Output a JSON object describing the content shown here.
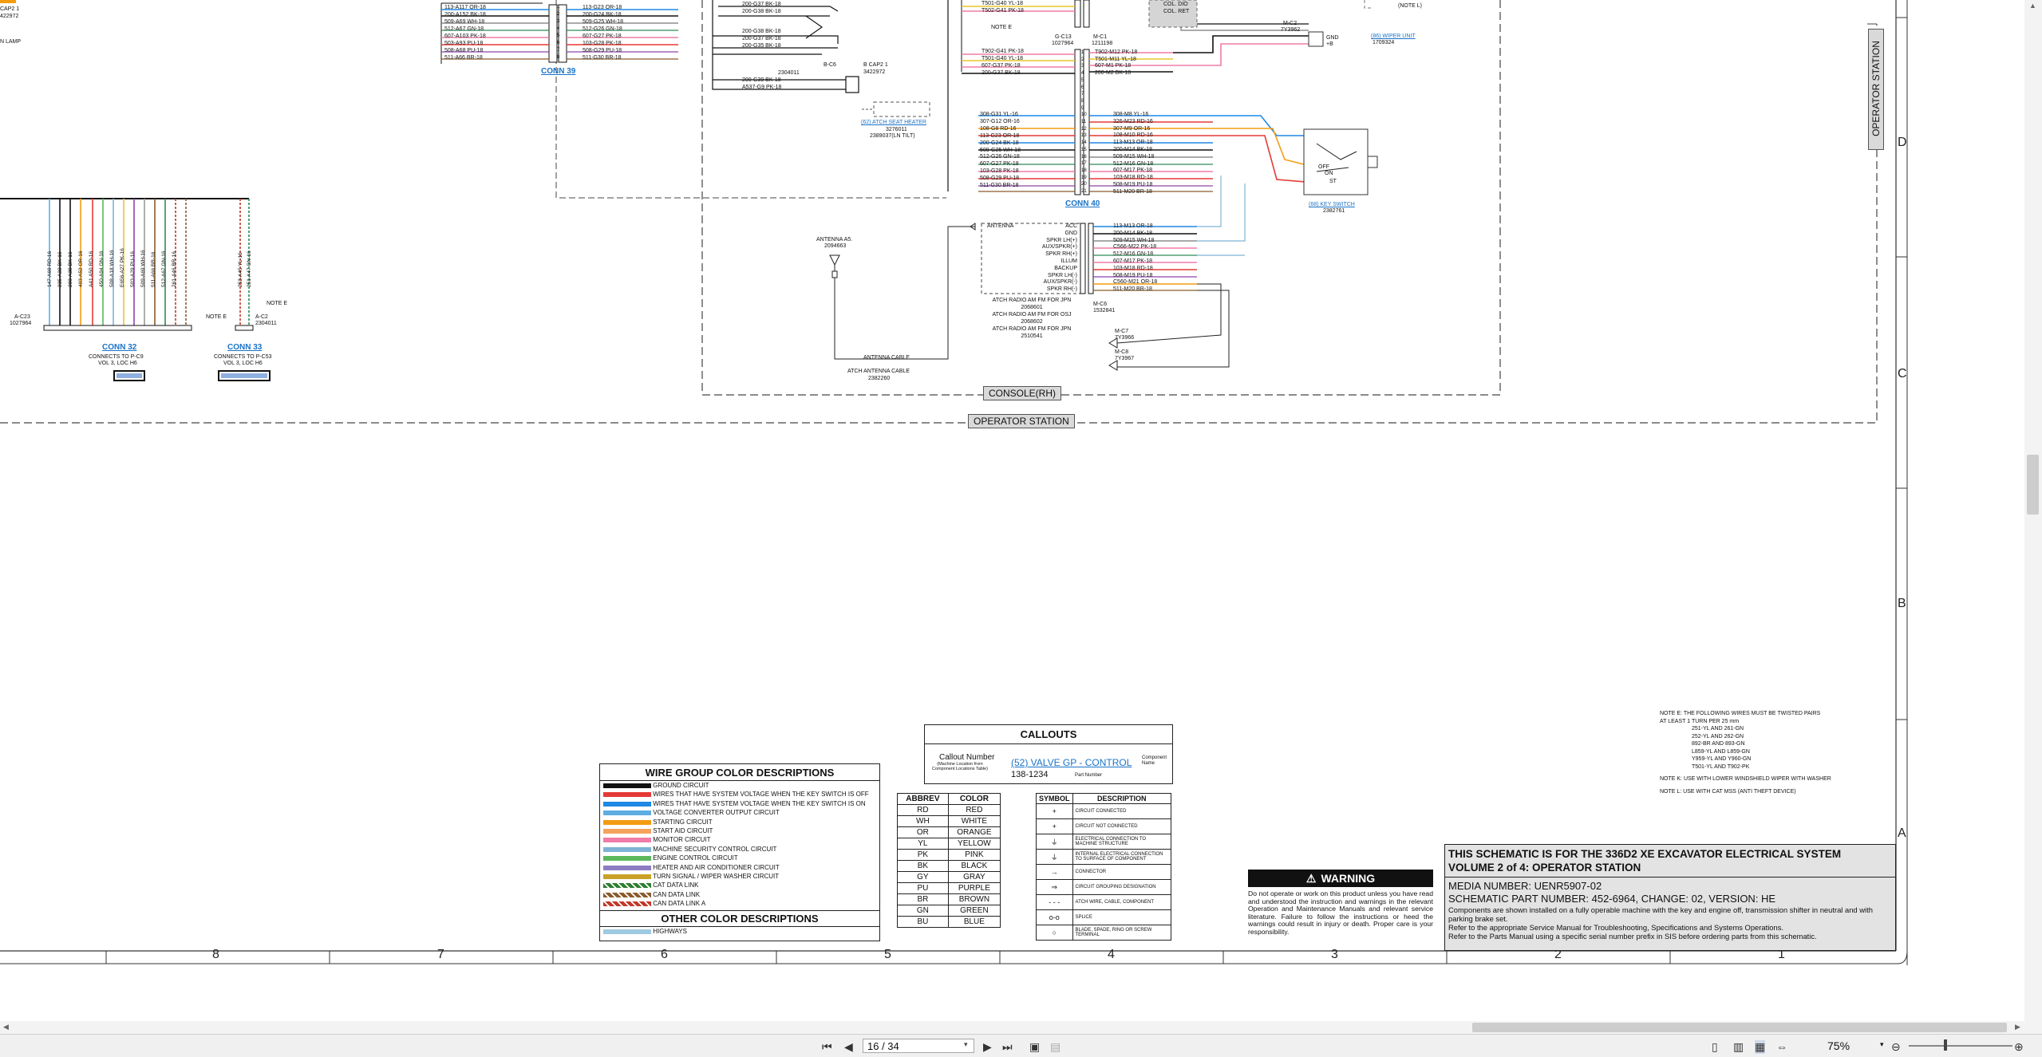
{
  "partial_labels": {
    "top_left_1": "CAP2 1",
    "top_left_2": "422972",
    "lamp": "N LAMP"
  },
  "connectors": {
    "conn39": "CONN 39",
    "conn40": "CONN 40",
    "conn32": "CONN 32",
    "conn33": "CONN 33",
    "conn32_note": "CONNECTS TO P-C9",
    "conn32_vol": "VOL 3, LOC H6",
    "conn33_note": "CONNECTS TO P-C53",
    "conn33_vol": "VOL 3, LOC H6",
    "ac23": "A-C23",
    "ac23_pn": "1027964",
    "ac2": "A-C2",
    "ac2_pn": "2304011",
    "note_e_1": "NOTE E",
    "note_e_2": "NOTE E",
    "note_e_3": "NOTE E",
    "bc6": "B-C6",
    "bc6_pn": "2304011",
    "bcap2": "B CAP2 1",
    "bcap2_pn": "3422972",
    "seat_heater": "(62) ATCH SEAT HEATER",
    "seat_heater_pn1": "3276011",
    "seat_heater_pn2": "2389037(LN TILT)",
    "gc13": "G-C13",
    "gc13_pn": "1027964",
    "mc1": "M-C1",
    "mc1_pn": "1211198",
    "mc2": "M-C2",
    "mc2_pn": "7Y3962",
    "gnd": "GND",
    "gnd2": "+B",
    "wiper_unit": "(86) WIPER UNIT",
    "wiper_pn": "1709324",
    "note_l": "(NOTE L)",
    "col_top1": "COL. DIO",
    "col_top2": "COL. RET",
    "key_switch": "(68) KEY SWITCH",
    "key_switch_pn": "2382761",
    "key_labels": [
      "OFF",
      "ON",
      "ST"
    ],
    "antenna": "ANTENNA A5.",
    "antenna_pn": "2094663",
    "antenna_cable": "ANTENNA CABLE",
    "atch_antenna": "ATCH ANTENNA CABLE",
    "atch_antenna_pn": "2382260",
    "radio_lines": [
      "ATCH RADIO AM FM FOR JPN",
      "2068601",
      "ATCH RADIO AM FM FOR OSJ",
      "2068602",
      "ATCH RADIO AM FM FOR JPN",
      "2510541"
    ],
    "radio_pins": [
      "ACC",
      "GND",
      "SPKR LH(+)",
      "AUX/SPKR(+)",
      "SPKR RH(+)",
      "ILLUM",
      "BACKUP",
      "SPKR LH(-)",
      "AUX/SPKR(-)",
      "SPKR RH(-)"
    ],
    "radio_antenna": "ANTENNA",
    "mc6": "M-C6",
    "mc6_pn": "1532841",
    "mc7": "M-C7",
    "mc7_pn": "7Y3966",
    "mc8": "M-C8",
    "mc8_pn": "7Y3967",
    "note_b": "NOTE B",
    "console_rh": "CONSOLE(RH)",
    "operator_station": "OPERATOR STATION",
    "operator_station_side": "OPERATOR STATION"
  },
  "wire_rows": {
    "conn39_left": [
      "113-A117 OR-18",
      "200-A152 BK-18",
      "509-A69 WH-18",
      "512-A67 GN-18",
      "607-A103 PK-18",
      "503-A93 PU-18",
      "508-A68 PU-18",
      "511-A66 BR-18"
    ],
    "conn39_right": [
      "113-G23 OR-18",
      "200-G24 BK-18",
      "509-G25 WH-18",
      "512-G26 GN-18",
      "607-G27 PK-18",
      "103-G28 PK-18",
      "508-G29 PU-18",
      "511-G30 BR-18"
    ],
    "conn39_pins": [
      "1",
      "2",
      "3",
      "4",
      "5",
      "6",
      "7",
      "8"
    ],
    "upper_mid": [
      "200-G37 BK-18",
      "200-G38 BK-18",
      "200-G38 BK-18",
      "200-G37 BK-18",
      "200-G35 BK-18"
    ],
    "lower_mid": [
      "200-G39 BK-18",
      "A537-G9 PK-18"
    ],
    "conn40_left_top": [
      "T501-G40 YL-18",
      "T502-G41 PK-18"
    ],
    "conn40_left_mid": [
      "T902-G41 PK-18",
      "T501-G40 YL-18",
      "607-G37 PK-18",
      "200-G37 BK-18"
    ],
    "conn40_left": [
      "308-G31 YL-16",
      "307-G12 OR-16",
      "108-G8 RD-16",
      "113-G23 OR-18",
      "200-G24 BK-18",
      "509-G25 WH-18",
      "512-G26 GN-18",
      "607-G27 PK-18",
      "103-G28 PK-18",
      "508-G29 PU-18",
      "511-G30 BR-18"
    ],
    "conn40_right_top": [
      "T902-M12 PK-18",
      "T501-M11 YL-18",
      "607-M1 PK-18",
      "200-M2 BK-18"
    ],
    "conn40_right": [
      "308-M8 YL-16",
      "326-M23 RD-16",
      "307-M9 OR-16",
      "108-M10 RD-16",
      "113-M13 OR-18",
      "200-M14 BK-18",
      "509-M15 WH-18",
      "512-M16 GN-18",
      "607-M17 PK-18",
      "103-M18 RD-18",
      "508-M19 PU-18",
      "511-M20 BR-18"
    ],
    "conn40_pins": [
      "1",
      "2",
      "3",
      "4",
      "5",
      "6",
      "7",
      "8",
      "9",
      "10",
      "11",
      "12",
      "13",
      "14",
      "15",
      "16",
      "17",
      "18",
      "19",
      "20",
      "21"
    ],
    "radio_wires": [
      "113-M13 OR-18",
      "200-M14 BK-18",
      "509-M15 WH-18",
      "C566-M22 PK-18",
      "512-M16 GN-18",
      "607-M17 PK-18",
      "103-M18 RD-18",
      "508-M19 PU-18",
      "C560-M21 OR-18",
      "511-M20 BR-18"
    ],
    "conn32_vertical": [
      "147-A69 RD-16",
      "235-A33 BK-16",
      "200-A38 BK-16",
      "403-A52 OR-16",
      "A41 A50 RD-16",
      "450-A94 GN-16",
      "508-A18 WH-16",
      "E656-A27 PK-16",
      "503-A29 PU-16",
      "509-A69 WH-16",
      "511-A66 BR-16",
      "512-A67 GN-16",
      "261-A46 BR-16"
    ],
    "conn33_vertical": [
      "253-A45 YL-16",
      "251-A47 GN-16"
    ]
  },
  "wire_group_legend": {
    "title": "WIRE GROUP COLOR DESCRIPTIONS",
    "items": [
      {
        "label": "GROUND CIRCUIT",
        "color": "#111111"
      },
      {
        "label": "WIRES THAT HAVE SYSTEM VOLTAGE WHEN THE KEY SWITCH IS OFF",
        "color": "#e53935"
      },
      {
        "label": "WIRES THAT HAVE SYSTEM VOLTAGE WHEN THE KEY SWITCH IS ON",
        "color": "#1e88e5"
      },
      {
        "label": "VOLTAGE CONVERTER OUTPUT CIRCUIT",
        "color": "#5dade2"
      },
      {
        "label": "STARTING CIRCUIT",
        "color": "#f39c12"
      },
      {
        "label": "START AID CIRCUIT",
        "color": "#f5a25d"
      },
      {
        "label": "MONITOR CIRCUIT",
        "color": "#f07ca8"
      },
      {
        "label": "MACHINE SECURITY CONTROL CIRCUIT",
        "color": "#7fb3d5"
      },
      {
        "label": "ENGINE CONTROL CIRCUIT",
        "color": "#5cb85c"
      },
      {
        "label": "HEATER AND AIR CONDITIONER CIRCUIT",
        "color": "#8e7cc3"
      },
      {
        "label": "TURN SIGNAL / WIPER WASHER CIRCUIT",
        "color": "#c9a227"
      },
      {
        "label": "CAT DATA LINK",
        "color": "#2e7d32"
      },
      {
        "label": "CAN DATA LINK",
        "color": "#8b5a2b"
      },
      {
        "label": "CAN DATA LINK A",
        "color": "#c0392b"
      }
    ],
    "other_title": "OTHER COLOR DESCRIPTIONS",
    "other_items": [
      {
        "label": "HIGHWAYS",
        "color": "#9ecae1"
      }
    ]
  },
  "callouts": {
    "title": "CALLOUTS",
    "callout_number": "Callout Number",
    "callout_sub": "(Machine Location from Component Locations Table)",
    "sample_link": "(52) VALVE GP - CONTROL",
    "component_name": "Component Name",
    "part_number_value": "138-1234",
    "part_number": "Part Number"
  },
  "abbrev_table": {
    "headers": [
      "ABBREV",
      "COLOR"
    ],
    "rows": [
      [
        "RD",
        "RED"
      ],
      [
        "WH",
        "WHITE"
      ],
      [
        "OR",
        "ORANGE"
      ],
      [
        "YL",
        "YELLOW"
      ],
      [
        "PK",
        "PINK"
      ],
      [
        "BK",
        "BLACK"
      ],
      [
        "GY",
        "GRAY"
      ],
      [
        "PU",
        "PURPLE"
      ],
      [
        "BR",
        "BROWN"
      ],
      [
        "GN",
        "GREEN"
      ],
      [
        "BU",
        "BLUE"
      ]
    ]
  },
  "symbol_table": {
    "headers": [
      "SYMBOL",
      "DESCRIPTION"
    ],
    "rows": [
      {
        "symbol": "+",
        "desc": "CIRCUIT CONNECTED"
      },
      {
        "symbol": "+",
        "desc": "CIRCUIT NOT CONNECTED"
      },
      {
        "symbol": "⏚",
        "desc": "ELECTRICAL CONNECTION TO MACHINE STRUCTURE"
      },
      {
        "symbol": "⏚",
        "desc": "INTERNAL ELECTRICAL CONNECTION TO SURFACE OF COMPONENT"
      },
      {
        "symbol": "→",
        "desc": "CONNECTOR"
      },
      {
        "symbol": "⇒",
        "desc": "CIRCUIT GROUPING DESIGNATION"
      },
      {
        "symbol": "- - -",
        "desc": "ATCH WIRE, CABLE, COMPONENT"
      },
      {
        "symbol": "o-o",
        "desc": "SPLICE"
      },
      {
        "symbol": "○",
        "desc": "BLADE, SPADE, RING OR SCREW TERMINAL"
      }
    ]
  },
  "warning": {
    "title": "WARNING",
    "text": "Do not operate or work on this product unless you have read and understood the instruction and warnings in the relevant Operation and Maintenance Manuals and relevant service literature. Failure to follow the instructions or heed the warnings could result in injury or death. Proper care is your responsibility."
  },
  "title_block": {
    "line1": "THIS SCHEMATIC IS FOR THE 336D2 XE EXCAVATOR ELECTRICAL SYSTEM",
    "line2": "VOLUME 2 of 4: OPERATOR STATION",
    "media": "MEDIA NUMBER: UENR5907-02",
    "part": "SCHEMATIC PART NUMBER: 452-6964, CHANGE: 02, VERSION: HE",
    "desc1": "Components are shown installed on a fully operable machine with the key and engine off, transmission shifter in neutral and with parking brake set.",
    "desc2": "Refer to the appropriate Service Manual for Troubleshooting, Specifications and Systems Operations.",
    "desc3": "Refer to the Parts Manual using a specific serial number prefix in SIS before ordering parts from this schematic."
  },
  "notes": {
    "note_e_title": "NOTE E: THE FOLLOWING WIRES MUST BE TWISTED PAIRS",
    "note_e_sub": "AT LEAST 1 TURN PER 25 mm",
    "note_e_pairs": [
      "251-YL AND 261-GN",
      "252-YL AND 262-GN",
      "892-BR AND 893-GN",
      "L859-YL AND L859-GN",
      "Y959-YL AND Y960-GN",
      "T501-YL AND T902-PK"
    ],
    "note_k": "NOTE K: USE WITH LOWER WINDSHIELD WIPER WITH WASHER",
    "note_l": "NOTE L: USE WITH CAT MSS (ANTI THEFT DEVICE)"
  },
  "grid": {
    "columns": [
      "8",
      "7",
      "6",
      "5",
      "4",
      "3",
      "2",
      "1"
    ],
    "rows": [
      "D",
      "C",
      "B",
      "A"
    ]
  },
  "viewer": {
    "page_value": "16 / 34",
    "zoom": "75%",
    "first_icon": "first-page-icon",
    "prev_icon": "prev-page-icon",
    "next_icon": "next-page-icon",
    "last_icon": "last-page-icon"
  }
}
